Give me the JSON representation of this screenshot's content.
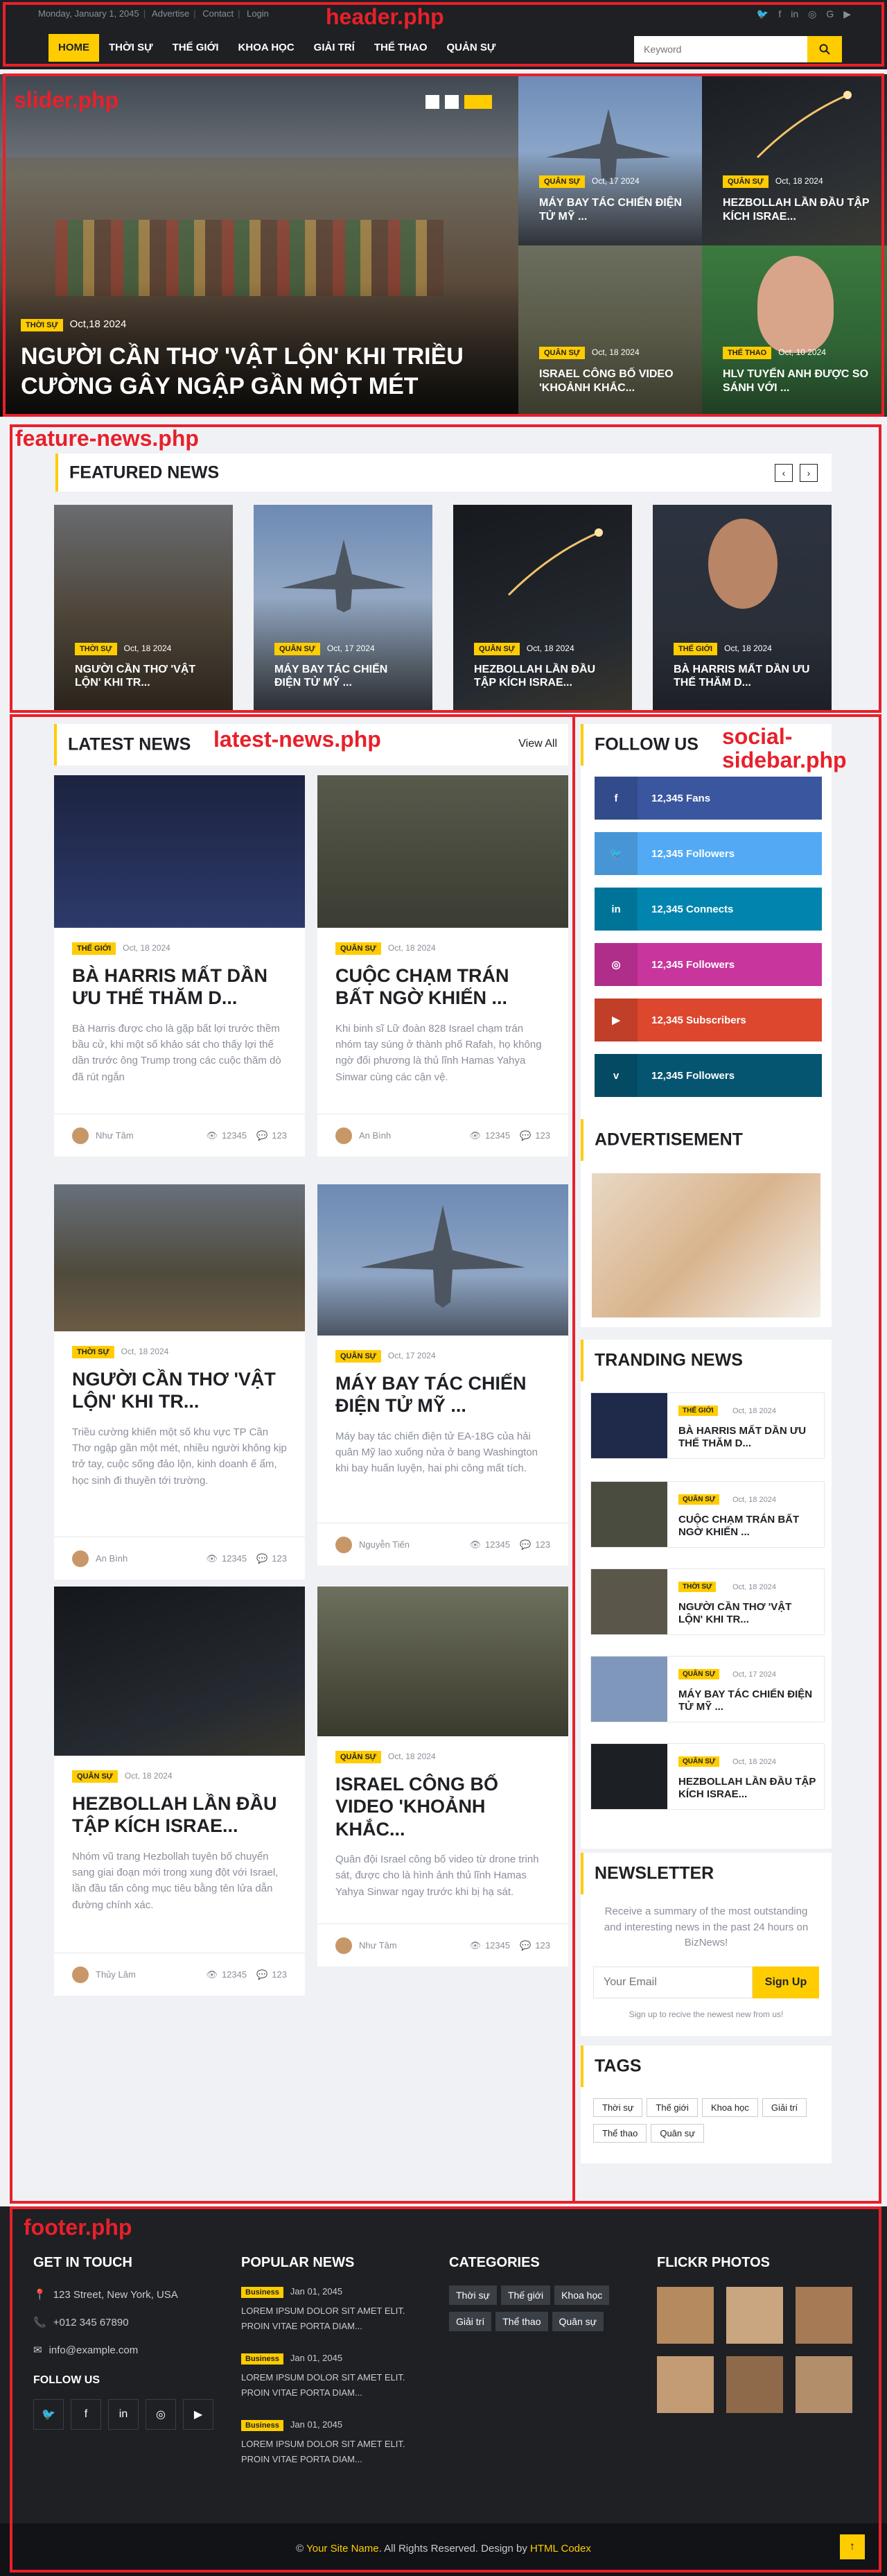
{
  "header": {
    "links": [
      "Monday, January 1, 2045",
      "Advertise",
      "Contact",
      "Login"
    ],
    "nav": [
      "Home",
      "Thời sự",
      "Thế giới",
      "Khoa học",
      "Giải trí",
      "Thể thao",
      "Quản sự"
    ],
    "search_placeholder": "Keyword"
  },
  "annotations": {
    "header": "header.php",
    "slider": "slider.php",
    "feature": "feature-news.php",
    "latest": "latest-news.php",
    "social": "social-\nsidebar.php",
    "footer": "footer.php"
  },
  "slider": {
    "main": {
      "cat": "Thời sự",
      "date": "Oct,18 2024",
      "title": "Người Cần Thơ 'vật lộn' khi triều cường gây ngập gần một mét"
    },
    "small": [
      {
        "cat": "Quân sự",
        "date": "Oct, 17 2024",
        "title": "Máy bay tác chiến điện tử Mỹ ..."
      },
      {
        "cat": "Quân sự",
        "date": "Oct, 18 2024",
        "title": "Hezbollah lần đầu tập kích Israe..."
      },
      {
        "cat": "Quân sự",
        "date": "Oct, 18 2024",
        "title": "Israel công bố video 'khoảnh khắc..."
      },
      {
        "cat": "Thể thao",
        "date": "Oct, 10 2024",
        "title": "HLV Tuyển Anh được so sánh với ..."
      }
    ]
  },
  "featured": {
    "heading": "Featured News",
    "items": [
      {
        "cat": "Thời sự",
        "date": "Oct, 18 2024",
        "title": "Người Cần Thơ 'vật lộn' khi tr..."
      },
      {
        "cat": "Quân sự",
        "date": "Oct, 17 2024",
        "title": "Máy bay tác chiến điện tử Mỹ ..."
      },
      {
        "cat": "Quân sự",
        "date": "Oct, 18 2024",
        "title": "Hezbollah lần đầu tập kích Israe..."
      },
      {
        "cat": "Thế giới",
        "date": "Oct, 18 2024",
        "title": "Bà Harris mất dần ưu thế thăm d..."
      }
    ]
  },
  "latest": {
    "heading": "Latest News",
    "view_all": "View All",
    "cards": [
      {
        "cat": "Thế giới",
        "date": "Oct, 18 2024",
        "title": "Bà Harris mất dần ưu thế thăm d...",
        "excerpt": "Bà Harris được cho là gặp bất lợi trước thềm bầu cử, khi một số khảo sát cho thấy lợi thế dần trước ông Trump trong các cuộc thăm dò đã rút ngắn",
        "author": "Như Tâm",
        "views": "12345",
        "comments": "123"
      },
      {
        "cat": "Quân sự",
        "date": "Oct, 18 2024",
        "title": "Cuộc chạm trán bất ngờ khiến ...",
        "excerpt": "Khi binh sĩ Lữ đoàn 828 Israel chạm trán nhóm tay súng ở thành phố Rafah, họ không ngờ đối phương là thủ lĩnh Hamas Yahya Sinwar cùng các cận vệ.",
        "author": "An Bình",
        "views": "12345",
        "comments": "123"
      },
      {
        "cat": "Thời sự",
        "date": "Oct, 18 2024",
        "title": "Người Cần Thơ 'vật lộn' khi tr...",
        "excerpt": "Triều cường khiến một số khu vực TP Cần Thơ ngập gần một mét, nhiều người không kịp trở tay, cuộc sống đảo lộn, kinh doanh ế ẩm, học sinh đi thuyền tới trường.",
        "author": "An Bình",
        "views": "12345",
        "comments": "123"
      },
      {
        "cat": "Quân sự",
        "date": "Oct, 17 2024",
        "title": "Máy bay tác chiến điện tử Mỹ ...",
        "excerpt": "Máy bay tác chiến điện tử EA-18G của hải quân Mỹ lao xuống nửa ở bang Washington khi bay huấn luyện, hai phi công mất tích.",
        "author": "Nguyễn Tiến",
        "views": "12345",
        "comments": "123"
      },
      {
        "cat": "Quân sự",
        "date": "Oct, 18 2024",
        "title": "Hezbollah lần đầu tập kích Israe...",
        "excerpt": "Nhóm vũ trang Hezbollah tuyên bố chuyển sang giai đoạn mới trong xung đột với Israel, lần đầu tấn công mục tiêu bằng tên lửa dẫn đường chính xác.",
        "author": "Thủy Lâm",
        "views": "12345",
        "comments": "123"
      },
      {
        "cat": "Quân sự",
        "date": "Oct, 18 2024",
        "title": "Israel công bố video 'khoảnh khắc...",
        "excerpt": "Quân đội Israel công bố video từ drone trinh sát, được cho là hình ảnh thủ lĩnh Hamas Yahya Sinwar ngay trước khi bị hạ sát.",
        "author": "Như Tâm",
        "views": "12345",
        "comments": "123"
      }
    ]
  },
  "sidebar": {
    "follow_heading": "Follow Us",
    "social": [
      {
        "icon": "facebook-icon",
        "glyph": "f",
        "label": "12,345 Fans",
        "color": "#39569e"
      },
      {
        "icon": "twitter-icon",
        "glyph": "🐦",
        "label": "12,345 Followers",
        "color": "#52aaf4"
      },
      {
        "icon": "linkedin-icon",
        "glyph": "in",
        "label": "12,345 Connects",
        "color": "#0185ae"
      },
      {
        "icon": "instagram-icon",
        "glyph": "◎",
        "label": "12,345 Followers",
        "color": "#c8359d"
      },
      {
        "icon": "youtube-icon",
        "glyph": "▶",
        "label": "12,345 Subscribers",
        "color": "#dc472e"
      },
      {
        "icon": "vimeo-icon",
        "glyph": "v",
        "label": "12,345 Followers",
        "color": "#055570"
      }
    ],
    "ad_heading": "Advertisement",
    "trending_heading": "Tranding News",
    "trending": [
      {
        "cat": "Thế giới",
        "date": "Oct, 18 2024",
        "title": "Bà Harris mất dần ưu thế thăm d..."
      },
      {
        "cat": "Quân sự",
        "date": "Oct, 18 2024",
        "title": "Cuộc chạm trán bất ngờ khiến ..."
      },
      {
        "cat": "Thời sự",
        "date": "Oct, 18 2024",
        "title": "Người Cần Thơ 'vật lộn' khi tr..."
      },
      {
        "cat": "Quân sự",
        "date": "Oct, 17 2024",
        "title": "Máy bay tác chiến điện tử Mỹ ..."
      },
      {
        "cat": "Quân sự",
        "date": "Oct, 18 2024",
        "title": "Hezbollah lần đầu tập kích Israe..."
      }
    ],
    "newsletter_heading": "Newsletter",
    "newsletter_text": "Receive a summary of the most outstanding and interesting news in the past 24 hours on BizNews!",
    "email_placeholder": "Your Email",
    "signup": "Sign Up",
    "newsletter_note": "Sign up to recive the newest new from us!",
    "tags_heading": "Tags",
    "tags": [
      "Thời sự",
      "Thế giới",
      "Khoa học",
      "Giải trí",
      "Thể thao",
      "Quân sự"
    ]
  },
  "footer": {
    "touch_heading": "Get In Touch",
    "address": "123 Street, New York, USA",
    "phone": "+012 345 67890",
    "email": "info@example.com",
    "follow_heading": "Follow Us",
    "popular_heading": "Popular News",
    "popular": [
      {
        "badge": "Business",
        "date": "Jan 01, 2045",
        "text": "Lorem ipsum dolor sit amet elit. Proin vitae porta diam..."
      },
      {
        "badge": "Business",
        "date": "Jan 01, 2045",
        "text": "Lorem ipsum dolor sit amet elit. Proin vitae porta diam..."
      },
      {
        "badge": "Business",
        "date": "Jan 01, 2045",
        "text": "Lorem ipsum dolor sit amet elit. Proin vitae porta diam..."
      }
    ],
    "categories_heading": "Categories",
    "categories": [
      "Thời sự",
      "Thế giới",
      "Khoa học",
      "Giải trí",
      "Thể thao",
      "Quân sự"
    ],
    "flickr_heading": "Flickr Photos",
    "copyright_pre": "© ",
    "site": "Your Site Name",
    "copyright_mid": ". All Rights Reserved. Design by ",
    "designer": "HTML Codex"
  }
}
